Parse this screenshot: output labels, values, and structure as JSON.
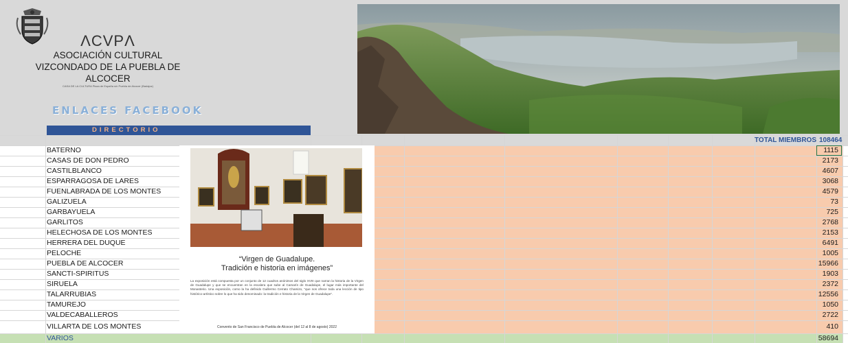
{
  "header": {
    "acronym": "ΛCVPΛ",
    "line1": "ASOCIACIÓN CULTURAL",
    "line2": "VIZCONDADO DE LA PUEBLA DE ALCOCER",
    "address": "CASA DE LA CULTURA Plaza de España s/n Puebla de Alcocer (Badajoz)",
    "facebook_title": "ENLACES FACEBOOK",
    "directory_label": "DIRECTORIO"
  },
  "totals": {
    "label": "TOTAL MIEMBROS",
    "value": "108464"
  },
  "rows": [
    {
      "town": "BATERNO",
      "members": "1115"
    },
    {
      "town": "CASAS DE DON PEDRO",
      "members": "2173"
    },
    {
      "town": "CASTILBLANCO",
      "members": "4607"
    },
    {
      "town": "ESPARRAGOSA DE LARES",
      "members": "3068"
    },
    {
      "town": "FUENLABRADA DE LOS MONTES",
      "members": "4579"
    },
    {
      "town": "GALIZUELA",
      "members": "73"
    },
    {
      "town": "GARBAYUELA",
      "members": "725"
    },
    {
      "town": "GARLITOS",
      "members": "2768"
    },
    {
      "town": "HELECHOSA DE LOS MONTES",
      "members": "2153"
    },
    {
      "town": "HERRERA DEL DUQUE",
      "members": "6491"
    },
    {
      "town": "PELOCHE",
      "members": "1005"
    },
    {
      "town": "PUEBLA DE  ALCOCER",
      "members": "15966"
    },
    {
      "town": "SANCTI-SPIRITUS",
      "members": "1903"
    },
    {
      "town": "SIRUELA",
      "members": "2372"
    },
    {
      "town": "TALARRUBIAS",
      "members": "12556"
    },
    {
      "town": "TAMUREJO",
      "members": "1050"
    },
    {
      "town": "VALDECABALLEROS",
      "members": "2722"
    },
    {
      "town": "VILLARTA DE LOS MONTES",
      "members": "410"
    }
  ],
  "varios": {
    "town": "VARIOS",
    "members": "58694"
  },
  "poster": {
    "title_line1": "“Virgen de Guadalupe.",
    "title_line2": "Tradición e historia en imágenes”",
    "body": "La exposición está compuesta por un conjunto de 12 cuadros anónimos del siglo XVIII que narran la historia de la Virgen de Guadalupe y que se encuentran en la escalera que sube al Camarín de Guadalupe, el lugar más importante del Monasterio. Una exposición, como la ha definido Guillermo Cerrato Chamizo, “que nos ofrece toda una lección de tipo histórico-artístico sobre lo que ha sido denominado: la tradición e historia de la Virgen de Guadalupe”.",
    "footer": "Convento de San Francisco de Puebla de Alcocer (del 12 al 8 de agosto) 2022"
  },
  "colors": {
    "header_bg": "#d9d9d9",
    "directory_bar": "#2f5597",
    "orange_fill": "#f8cbad",
    "green_fill": "#c6e0b4",
    "total_text": "#2f5597"
  },
  "icons": {
    "logo": "coat-of-arms-icon"
  }
}
